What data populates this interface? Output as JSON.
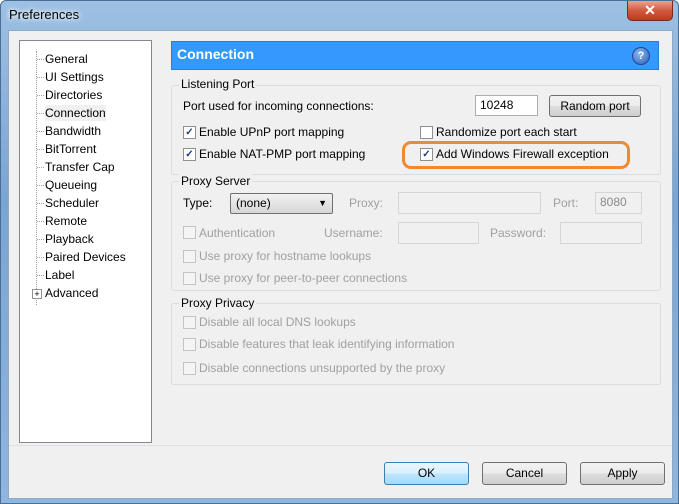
{
  "window": {
    "title": "Preferences",
    "close_glyph": "✕"
  },
  "sidebar": {
    "items": [
      {
        "label": "General"
      },
      {
        "label": "UI Settings"
      },
      {
        "label": "Directories"
      },
      {
        "label": "Connection",
        "selected": true
      },
      {
        "label": "Bandwidth"
      },
      {
        "label": "BitTorrent"
      },
      {
        "label": "Transfer Cap"
      },
      {
        "label": "Queueing"
      },
      {
        "label": "Scheduler"
      },
      {
        "label": "Remote"
      },
      {
        "label": "Playback"
      },
      {
        "label": "Paired Devices"
      },
      {
        "label": "Label"
      },
      {
        "label": "Advanced",
        "expandable": true
      }
    ],
    "expander_glyph": "+"
  },
  "header": {
    "title": "Connection",
    "help": "?"
  },
  "listening_port": {
    "legend": "Listening Port",
    "port_label": "Port used for incoming connections:",
    "port_value": "10248",
    "random_button": "Random port",
    "upnp": {
      "label": "Enable UPnP port mapping",
      "checked": true
    },
    "natpmp": {
      "label": "Enable NAT-PMP port mapping",
      "checked": true
    },
    "randomize": {
      "label": "Randomize port each start",
      "checked": false
    },
    "firewall": {
      "label": "Add Windows Firewall exception",
      "checked": true
    },
    "check_glyph": "✓"
  },
  "proxy_server": {
    "legend": "Proxy Server",
    "type_label": "Type:",
    "type_value": "(none)",
    "proxy_label": "Proxy:",
    "proxy_value": "",
    "port_label": "Port:",
    "port_value": "8080",
    "auth_label": "Authentication",
    "username_label": "Username:",
    "password_label": "Password:",
    "hostname_label": "Use proxy for hostname lookups",
    "p2p_label": "Use proxy for peer-to-peer connections",
    "dropdown_glyph": "▼"
  },
  "proxy_privacy": {
    "legend": "Proxy Privacy",
    "dns_label": "Disable all local DNS lookups",
    "leak_label": "Disable features that leak identifying information",
    "unsupported_label": "Disable connections unsupported by the proxy"
  },
  "buttons": {
    "ok": "OK",
    "cancel": "Cancel",
    "apply": "Apply"
  },
  "colors": {
    "header_bg": "#3399ff",
    "highlight": "#f08a30"
  }
}
